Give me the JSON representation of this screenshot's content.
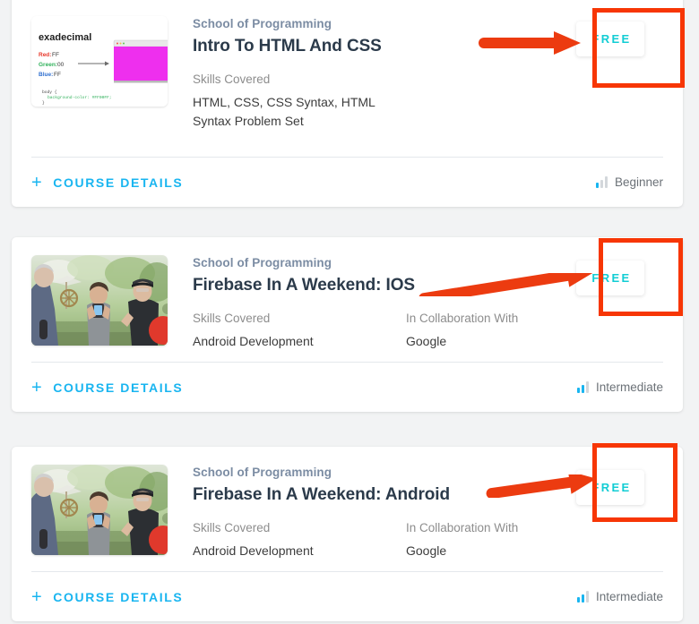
{
  "page": {
    "background_color": "#f2f3f4",
    "accent_link_color": "#19b5f0",
    "price_color": "#12cdd4",
    "annotation_color": "#f73605",
    "school_color": "#7b8ca3",
    "title_color": "#2b3a4a"
  },
  "labels": {
    "skills_covered": "Skills Covered",
    "collaboration": "In Collaboration With",
    "course_details": "COURSE DETAILS",
    "plus_glyph": "+"
  },
  "courses": [
    {
      "school": "School of Programming",
      "title": "Intro To HTML And CSS",
      "skills_label": "Skills Covered",
      "skills_value": "HTML, CSS, CSS Syntax, HTML Syntax Problem Set",
      "collab_label": "",
      "collab_value": "",
      "price": "FREE",
      "details_label": "COURSE DETAILS",
      "difficulty": "Beginner",
      "difficulty_level": 1,
      "thumbnail_name": "hexadecimal-color-lesson-thumbnail",
      "thumbnail_texts": {
        "heading": "exadecimal",
        "red": "Red: FF",
        "green": "Green: 00",
        "blue": "Blue: FF",
        "code_line_1": "body {",
        "code_line_2": "background-color: #FF00FF;",
        "code_line_3": "}",
        "swatch_color": "#ee2fee"
      }
    },
    {
      "school": "School of Programming",
      "title": "Firebase In A Weekend: IOS",
      "skills_label": "Skills Covered",
      "skills_value": "Android Development",
      "collab_label": "In Collaboration With",
      "collab_value": "Google",
      "price": "FREE",
      "details_label": "COURSE DETAILS",
      "difficulty": "Intermediate",
      "difficulty_level": 2,
      "thumbnail_name": "three-people-outdoors-photo",
      "thumbnail_texts": null
    },
    {
      "school": "School of Programming",
      "title": "Firebase In A Weekend: Android",
      "skills_label": "Skills Covered",
      "skills_value": "Android Development",
      "collab_label": "In Collaboration With",
      "collab_value": "Google",
      "price": "FREE",
      "details_label": "COURSE DETAILS",
      "difficulty": "Intermediate",
      "difficulty_level": 2,
      "thumbnail_name": "three-people-outdoors-photo",
      "thumbnail_texts": null
    }
  ],
  "annotations": {
    "arrows": [
      {
        "name": "arrow-to-free-badge-1"
      },
      {
        "name": "arrow-to-free-badge-2"
      },
      {
        "name": "arrow-to-free-badge-3"
      }
    ],
    "boxes": [
      {
        "name": "highlight-box-free-badge-1"
      },
      {
        "name": "highlight-box-free-badge-2"
      },
      {
        "name": "highlight-box-free-badge-3"
      }
    ]
  }
}
